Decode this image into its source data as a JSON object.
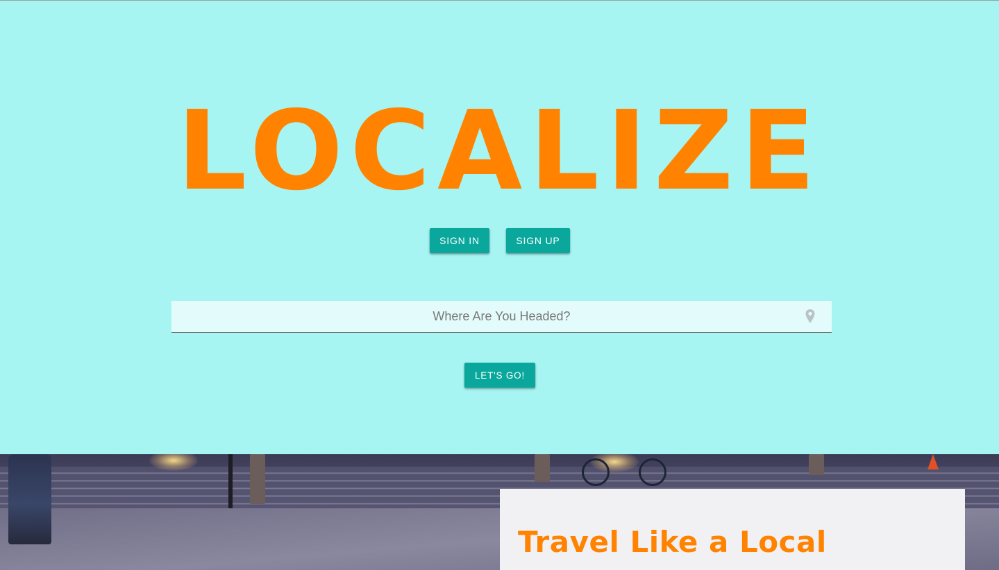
{
  "brand": {
    "logo_text": "LOCALIZE",
    "accent_color": "#ff8300",
    "hero_background": "#a7f5f3",
    "button_color": "#0aa89c"
  },
  "auth": {
    "sign_in_label": "SIGN IN",
    "sign_up_label": "SIGN UP"
  },
  "search": {
    "value": "",
    "placeholder": "Where Are You Headed?",
    "icon": "map-pin-icon"
  },
  "cta": {
    "go_label": "LET'S GO!"
  },
  "feature_card": {
    "title": "Travel Like a Local"
  }
}
